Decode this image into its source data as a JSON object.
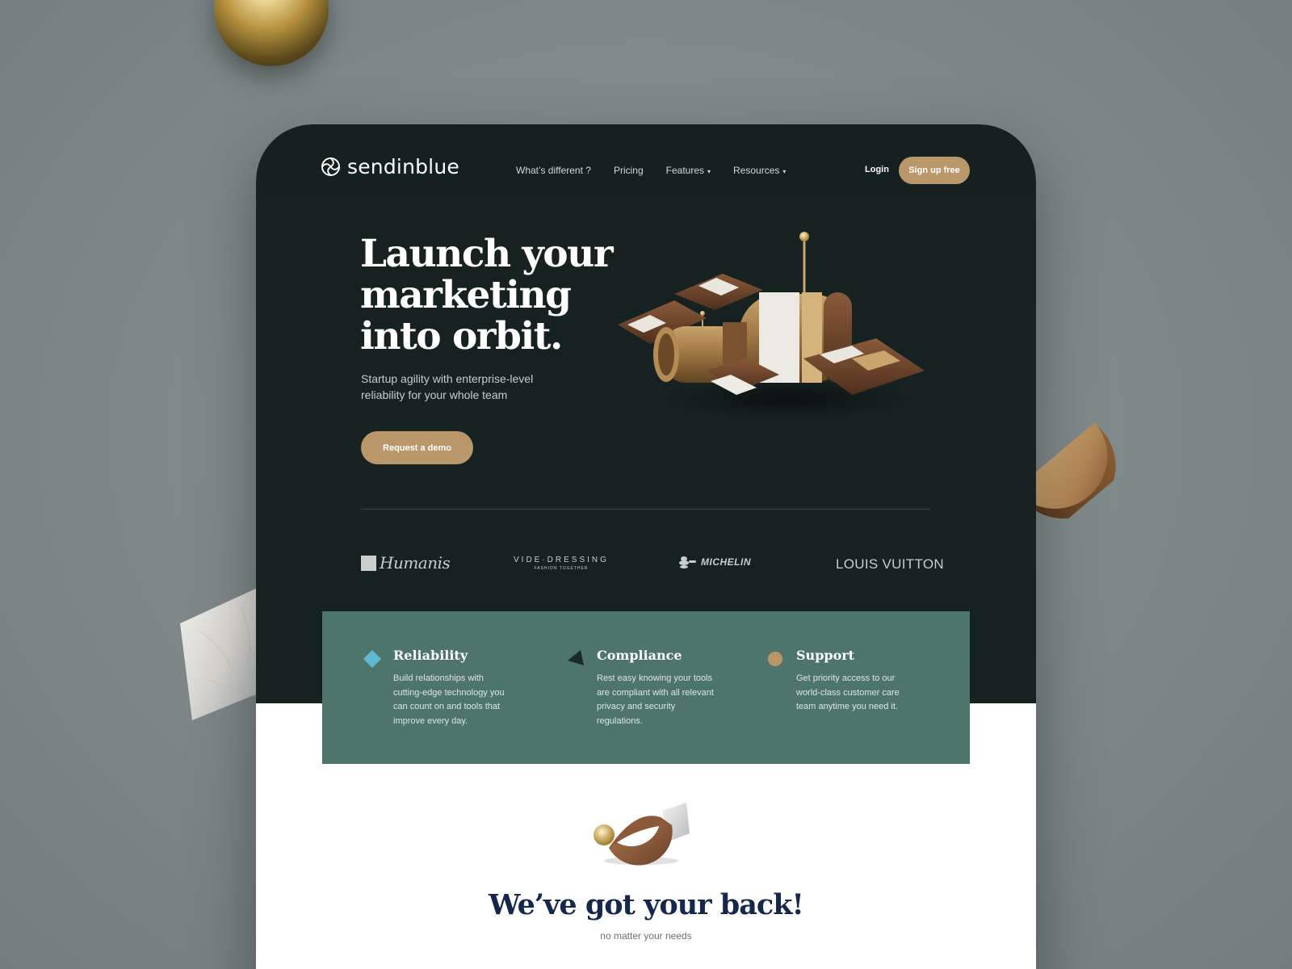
{
  "brand": {
    "name": "sendinblue"
  },
  "nav": {
    "items": [
      {
        "label": "What’s different ?",
        "has_dropdown": false
      },
      {
        "label": "Pricing",
        "has_dropdown": false
      },
      {
        "label": "Features",
        "has_dropdown": true
      },
      {
        "label": "Resources",
        "has_dropdown": true
      }
    ],
    "login": "Login",
    "signup": "Sign up free"
  },
  "hero": {
    "headline": "Launch your marketing into orbit.",
    "subline": "Startup agility with enterprise-level reliability for your whole team",
    "cta": "Request a demo"
  },
  "clients": {
    "humanis": "Humanis",
    "vide_main": "VIDE·DRESSING",
    "vide_sub": "FASHION TOGETHER",
    "michelin": "MICHELIN",
    "louis_vuitton": "LOUIS VUITTON"
  },
  "features": [
    {
      "title": "Reliability",
      "description": "Build relationships with cutting-edge technology you can count on and tools that improve every day.",
      "icon": "diamond-icon",
      "icon_color": "#62b8d3"
    },
    {
      "title": "Compliance",
      "description": "Rest easy knowing your tools are compliant with all relevant privacy and security regulations.",
      "icon": "triangle-icon",
      "icon_color": "#1b2a29"
    },
    {
      "title": "Support",
      "description": "Get priority access to our world-class customer care team anytime you need it.",
      "icon": "circle-icon",
      "icon_color": "#b9976b"
    }
  ],
  "section": {
    "title": "We’ve got your back!",
    "subtitle": "no matter your needs"
  },
  "colors": {
    "hero_bg": "#172322",
    "accent": "#b9976b",
    "features_bg": "#4e756b",
    "heading_navy": "#15274a",
    "page_bg": "#7f8a8a"
  }
}
